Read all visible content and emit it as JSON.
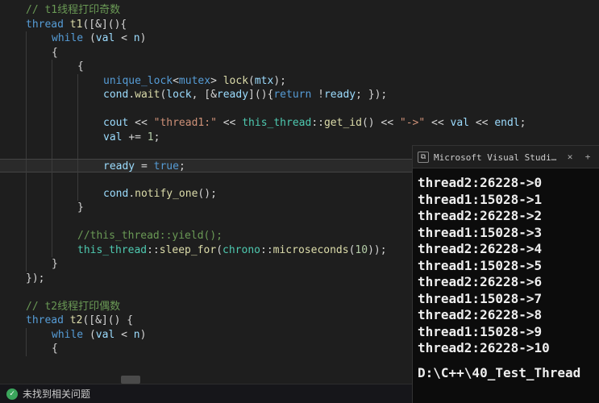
{
  "code": {
    "lines": [
      {
        "indent": 1,
        "class": "",
        "tokens": [
          {
            "c": "cm",
            "t": "// t1线程打印奇数"
          }
        ]
      },
      {
        "indent": 1,
        "class": "",
        "tokens": [
          {
            "c": "ty",
            "t": "thread"
          },
          {
            "c": "txt",
            "t": " "
          },
          {
            "c": "fn",
            "t": "t1"
          },
          {
            "c": "punc",
            "t": "(["
          },
          {
            "c": "op",
            "t": "&"
          },
          {
            "c": "punc",
            "t": "](){"
          }
        ]
      },
      {
        "indent": 2,
        "class": "",
        "tokens": [
          {
            "c": "kw",
            "t": "while"
          },
          {
            "c": "txt",
            "t": " "
          },
          {
            "c": "punc",
            "t": "("
          },
          {
            "c": "id",
            "t": "val"
          },
          {
            "c": "txt",
            "t": " "
          },
          {
            "c": "op",
            "t": "<"
          },
          {
            "c": "txt",
            "t": " "
          },
          {
            "c": "id",
            "t": "n"
          },
          {
            "c": "punc",
            "t": ")"
          }
        ]
      },
      {
        "indent": 2,
        "class": "",
        "tokens": [
          {
            "c": "punc",
            "t": "{"
          }
        ]
      },
      {
        "indent": 3,
        "class": "",
        "tokens": [
          {
            "c": "punc",
            "t": "{"
          }
        ]
      },
      {
        "indent": 4,
        "class": "",
        "tokens": [
          {
            "c": "ty",
            "t": "unique_lock"
          },
          {
            "c": "punc",
            "t": "<"
          },
          {
            "c": "ty",
            "t": "mutex"
          },
          {
            "c": "punc",
            "t": "> "
          },
          {
            "c": "fn",
            "t": "lock"
          },
          {
            "c": "punc",
            "t": "("
          },
          {
            "c": "id",
            "t": "mtx"
          },
          {
            "c": "punc",
            "t": ");"
          }
        ]
      },
      {
        "indent": 4,
        "class": "",
        "tokens": [
          {
            "c": "id",
            "t": "cond"
          },
          {
            "c": "punc",
            "t": "."
          },
          {
            "c": "fn",
            "t": "wait"
          },
          {
            "c": "punc",
            "t": "("
          },
          {
            "c": "id",
            "t": "lock"
          },
          {
            "c": "punc",
            "t": ", ["
          },
          {
            "c": "op",
            "t": "&"
          },
          {
            "c": "id",
            "t": "ready"
          },
          {
            "c": "punc",
            "t": "](){"
          },
          {
            "c": "kw",
            "t": "return"
          },
          {
            "c": "txt",
            "t": " "
          },
          {
            "c": "op",
            "t": "!"
          },
          {
            "c": "id",
            "t": "ready"
          },
          {
            "c": "punc",
            "t": "; });"
          }
        ]
      },
      {
        "indent": 4,
        "class": "",
        "tokens": [
          {
            "c": "txt",
            "t": ""
          }
        ]
      },
      {
        "indent": 4,
        "class": "",
        "tokens": [
          {
            "c": "id",
            "t": "cout"
          },
          {
            "c": "txt",
            "t": " "
          },
          {
            "c": "op",
            "t": "<<"
          },
          {
            "c": "txt",
            "t": " "
          },
          {
            "c": "str",
            "t": "\"thread1:\""
          },
          {
            "c": "txt",
            "t": " "
          },
          {
            "c": "op",
            "t": "<<"
          },
          {
            "c": "txt",
            "t": " "
          },
          {
            "c": "ns",
            "t": "this_thread"
          },
          {
            "c": "punc",
            "t": "::"
          },
          {
            "c": "fn",
            "t": "get_id"
          },
          {
            "c": "punc",
            "t": "()"
          },
          {
            "c": "txt",
            "t": " "
          },
          {
            "c": "op",
            "t": "<<"
          },
          {
            "c": "txt",
            "t": " "
          },
          {
            "c": "str",
            "t": "\"->\""
          },
          {
            "c": "txt",
            "t": " "
          },
          {
            "c": "op",
            "t": "<<"
          },
          {
            "c": "txt",
            "t": " "
          },
          {
            "c": "id",
            "t": "val"
          },
          {
            "c": "txt",
            "t": " "
          },
          {
            "c": "op",
            "t": "<<"
          },
          {
            "c": "txt",
            "t": " "
          },
          {
            "c": "id",
            "t": "endl"
          },
          {
            "c": "punc",
            "t": ";"
          }
        ]
      },
      {
        "indent": 4,
        "class": "",
        "tokens": [
          {
            "c": "id",
            "t": "val"
          },
          {
            "c": "txt",
            "t": " "
          },
          {
            "c": "op",
            "t": "+="
          },
          {
            "c": "txt",
            "t": " "
          },
          {
            "c": "num",
            "t": "1"
          },
          {
            "c": "punc",
            "t": ";"
          }
        ]
      },
      {
        "indent": 4,
        "class": "",
        "tokens": [
          {
            "c": "txt",
            "t": ""
          }
        ]
      },
      {
        "indent": 4,
        "class": "cursor-line",
        "tokens": [
          {
            "c": "id",
            "t": "ready"
          },
          {
            "c": "txt",
            "t": " "
          },
          {
            "c": "op",
            "t": "="
          },
          {
            "c": "txt",
            "t": " "
          },
          {
            "c": "bool",
            "t": "true"
          },
          {
            "c": "punc",
            "t": ";"
          }
        ]
      },
      {
        "indent": 4,
        "class": "",
        "tokens": [
          {
            "c": "txt",
            "t": ""
          }
        ]
      },
      {
        "indent": 4,
        "class": "",
        "tokens": [
          {
            "c": "id",
            "t": "cond"
          },
          {
            "c": "punc",
            "t": "."
          },
          {
            "c": "fn",
            "t": "notify_one"
          },
          {
            "c": "punc",
            "t": "();"
          }
        ]
      },
      {
        "indent": 3,
        "class": "",
        "tokens": [
          {
            "c": "punc",
            "t": "}"
          }
        ]
      },
      {
        "indent": 3,
        "class": "",
        "tokens": [
          {
            "c": "txt",
            "t": ""
          }
        ]
      },
      {
        "indent": 3,
        "class": "",
        "tokens": [
          {
            "c": "cm",
            "t": "//this_thread::yield();"
          }
        ]
      },
      {
        "indent": 3,
        "class": "",
        "tokens": [
          {
            "c": "ns",
            "t": "this_thread"
          },
          {
            "c": "punc",
            "t": "::"
          },
          {
            "c": "fn",
            "t": "sleep_for"
          },
          {
            "c": "punc",
            "t": "("
          },
          {
            "c": "ns",
            "t": "chrono"
          },
          {
            "c": "punc",
            "t": "::"
          },
          {
            "c": "fn",
            "t": "microseconds"
          },
          {
            "c": "punc",
            "t": "("
          },
          {
            "c": "num",
            "t": "10"
          },
          {
            "c": "punc",
            "t": "));"
          }
        ]
      },
      {
        "indent": 2,
        "class": "",
        "tokens": [
          {
            "c": "punc",
            "t": "}"
          }
        ]
      },
      {
        "indent": 1,
        "class": "",
        "tokens": [
          {
            "c": "punc",
            "t": "});"
          }
        ]
      },
      {
        "indent": 1,
        "class": "",
        "tokens": [
          {
            "c": "txt",
            "t": ""
          }
        ]
      },
      {
        "indent": 1,
        "class": "",
        "tokens": [
          {
            "c": "cm",
            "t": "// t2线程打印偶数"
          }
        ]
      },
      {
        "indent": 1,
        "class": "",
        "tokens": [
          {
            "c": "ty",
            "t": "thread"
          },
          {
            "c": "txt",
            "t": " "
          },
          {
            "c": "fn",
            "t": "t2"
          },
          {
            "c": "punc",
            "t": "(["
          },
          {
            "c": "op",
            "t": "&"
          },
          {
            "c": "punc",
            "t": "]() {"
          }
        ]
      },
      {
        "indent": 2,
        "class": "",
        "tokens": [
          {
            "c": "kw",
            "t": "while"
          },
          {
            "c": "txt",
            "t": " "
          },
          {
            "c": "punc",
            "t": "("
          },
          {
            "c": "id",
            "t": "val"
          },
          {
            "c": "txt",
            "t": " "
          },
          {
            "c": "op",
            "t": "<"
          },
          {
            "c": "txt",
            "t": " "
          },
          {
            "c": "id",
            "t": "n"
          },
          {
            "c": "punc",
            "t": ")"
          }
        ]
      },
      {
        "indent": 2,
        "class": "",
        "tokens": [
          {
            "c": "punc",
            "t": "{"
          }
        ]
      }
    ]
  },
  "status": {
    "ok_glyph": "✓",
    "text": "未找到相关问题"
  },
  "terminal": {
    "icon_glyph": "⧉",
    "title": "Microsoft Visual Studio 调试",
    "close": "✕",
    "add": "+",
    "lines": [
      "thread2:26228->0",
      "thread1:15028->1",
      "thread2:26228->2",
      "thread1:15028->3",
      "thread2:26228->4",
      "thread1:15028->5",
      "thread2:26228->6",
      "thread1:15028->7",
      "thread2:26228->8",
      "thread1:15028->9",
      "thread2:26228->10"
    ],
    "path": "D:\\C++\\40_Test_Thread"
  }
}
